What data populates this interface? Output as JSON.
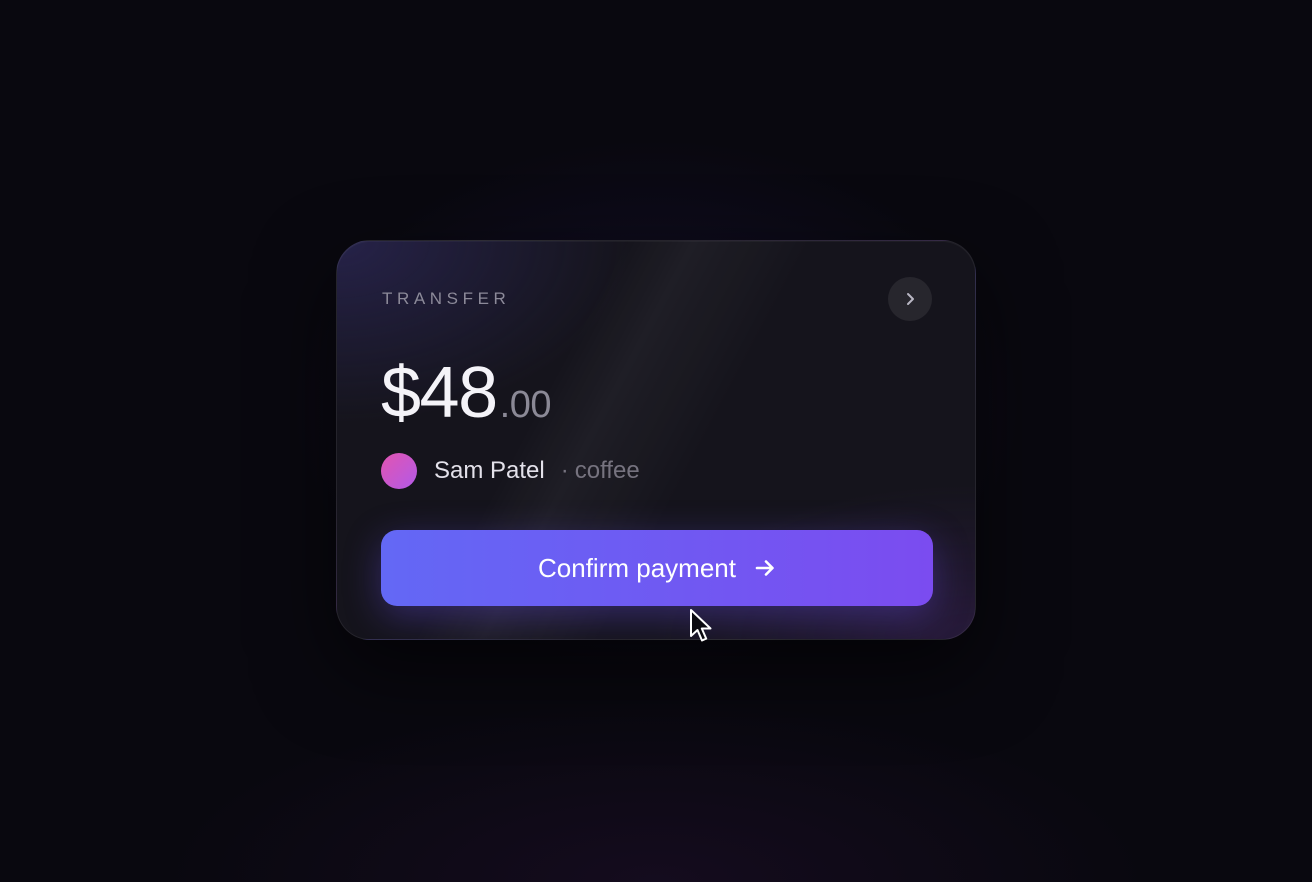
{
  "card": {
    "label": "TRANSFER",
    "amount_whole": "$48",
    "amount_cents": ".00",
    "payee_name": "Sam Patel",
    "payee_note": "coffee",
    "confirm_label": "Confirm payment"
  },
  "icons": {
    "details": "chevron-right-icon",
    "confirm": "arrow-right-icon",
    "pointer": "mouse-cursor-icon"
  },
  "colors": {
    "accent_start": "#6368f5",
    "accent_end": "#7b4cf0",
    "avatar_start": "#e254b0",
    "avatar_end": "#b25ae8",
    "background": "#09080f"
  }
}
